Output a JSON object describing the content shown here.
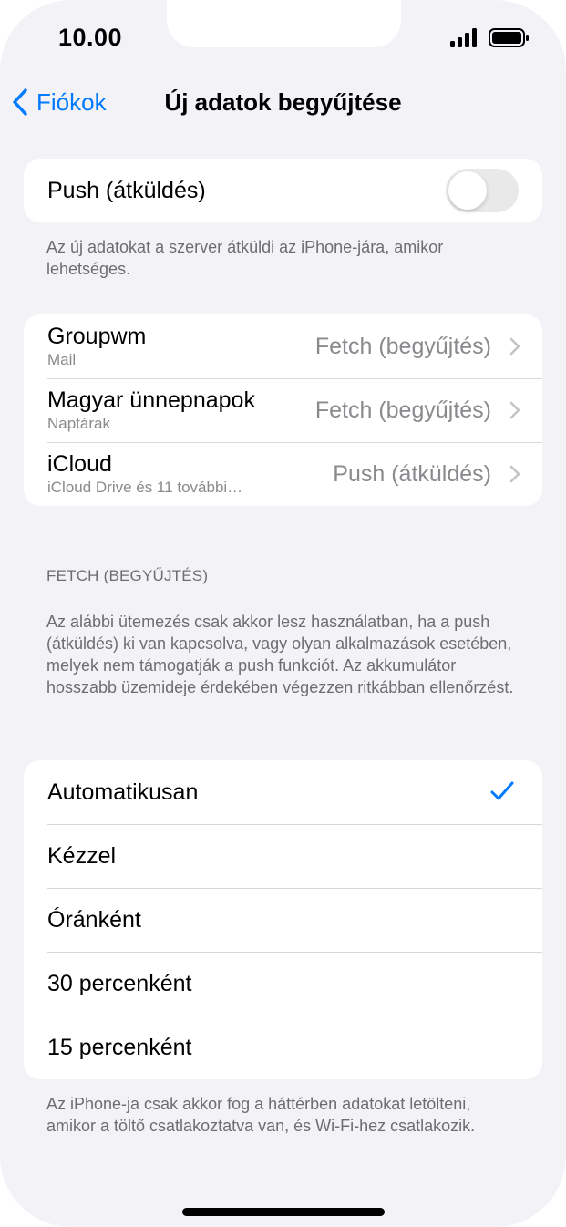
{
  "status": {
    "time": "10.00"
  },
  "nav": {
    "back_label": "Fiókok",
    "title": "Új adatok begyűjtése"
  },
  "push": {
    "label": "Push (átküldés)",
    "enabled": false,
    "footer": "Az új adatokat a szerver átküldi az iPhone-jára, amikor lehetséges."
  },
  "accounts": [
    {
      "name": "Groupwm",
      "sub": "Mail",
      "value": "Fetch (begyűjtés)"
    },
    {
      "name": "Magyar ünnepnapok",
      "sub": "Naptárak",
      "value": "Fetch (begyűjtés)"
    },
    {
      "name": "iCloud",
      "sub": "iCloud Drive és 11 további…",
      "value": "Push (átküldés)"
    }
  ],
  "fetch": {
    "header": "FETCH (BEGYŰJTÉS)",
    "description": "Az alábbi ütemezés csak akkor lesz használatban, ha a push (átküldés) ki van kapcsolva, vagy olyan alkalmazások esetében, melyek nem támogatják a push funkciót. Az akkumulátor hosszabb üzemideje érdekében végezzen ritkábban ellenőrzést.",
    "options": [
      {
        "label": "Automatikusan",
        "selected": true
      },
      {
        "label": "Kézzel",
        "selected": false
      },
      {
        "label": "Óránként",
        "selected": false
      },
      {
        "label": "30 percenként",
        "selected": false
      },
      {
        "label": "15 percenként",
        "selected": false
      }
    ],
    "footer": "Az iPhone-ja csak akkor fog a háttérben adatokat letölteni, amikor a töltő csatlakoztatva van, és Wi-Fi-hez csatlakozik."
  },
  "colors": {
    "accent": "#007aff",
    "background": "#f2f2f7",
    "secondary_text": "#8a8a8e"
  }
}
